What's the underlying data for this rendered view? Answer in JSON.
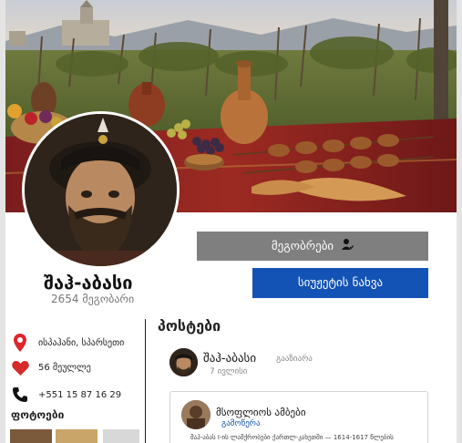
{
  "profile": {
    "name": "შაჰ-აბასი",
    "friends_count": "2654 მეგობარი"
  },
  "buttons": {
    "friends_label": "მეგობრები",
    "story_label": "სიუჟეტის ნახვა"
  },
  "info": {
    "location": "ისპაჰანი, სპარსეთი",
    "followers": "56 მეულლე",
    "phone": "+551 15 87 16 29"
  },
  "photos": {
    "title": "ფოტოები"
  },
  "posts": {
    "title": "პოსტები",
    "items": [
      {
        "author": "შაჰ-აბასი",
        "action": "გააზიარა",
        "date": "7 ივლისი",
        "shared": {
          "title": "მსოფლიოს ამბები",
          "link": "გამოწერა",
          "text": "შაჰ-აბას I-ის ლაშქრობები ქართლ-კახეთში — 1614-1617 წლების"
        }
      }
    ]
  },
  "colors": {
    "primary_button": "#1453b6",
    "secondary_button": "#7f7f7f",
    "location_pin": "#e0242c",
    "heart": "#d62b2b"
  },
  "icons": {
    "friends_button_icon": "person-check-icon",
    "location": "location-pin-icon",
    "followers": "heart-icon",
    "phone": "phone-icon"
  }
}
